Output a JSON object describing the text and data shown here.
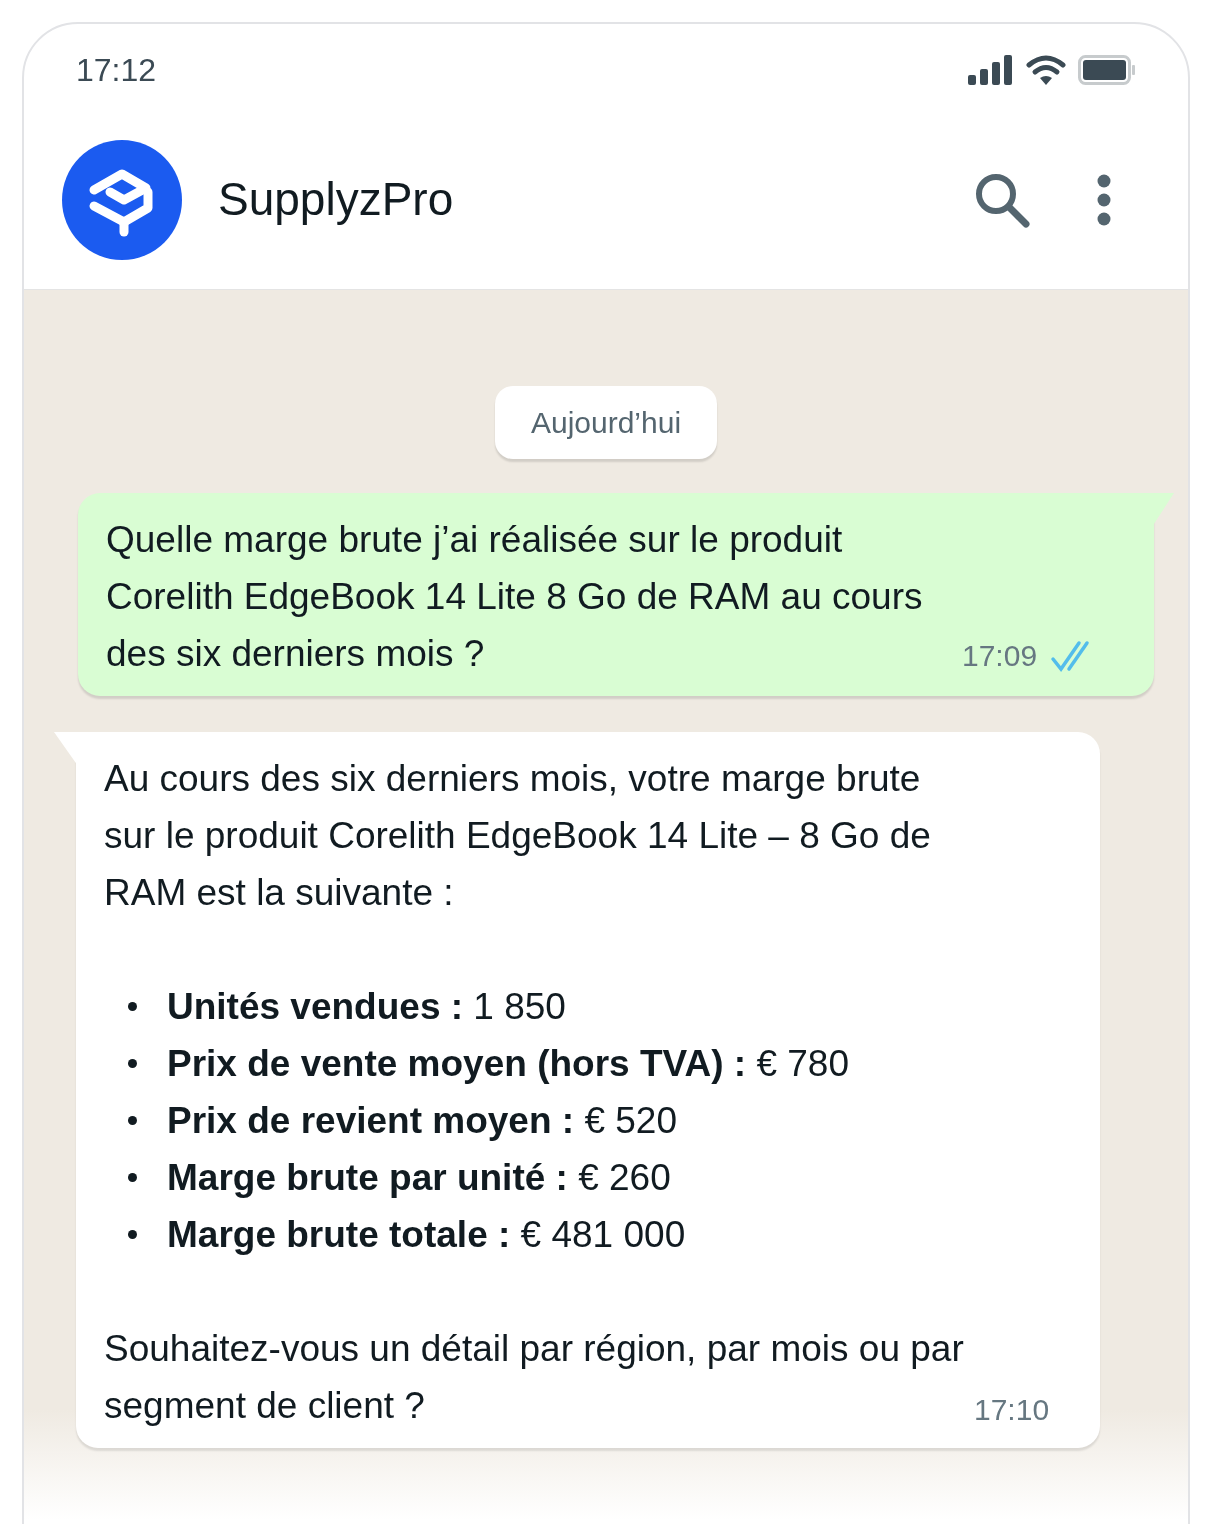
{
  "status_bar": {
    "time": "17:12"
  },
  "header": {
    "title": "SupplyzPro"
  },
  "date_chip": "Aujourd’hui",
  "messages": [
    {
      "kind": "outgoing",
      "text": "Quelle marge brute j’ai réalisée sur le produit Corelith EdgeBook 14 Lite 8 Go de RAM au cours des six derniers mois ?",
      "time": "17:09",
      "read": true
    },
    {
      "kind": "incoming",
      "intro": "Au cours des six derniers mois, votre marge brute sur le produit Corelith EdgeBook 14 Lite – 8 Go de RAM est la suivante :",
      "bullets": [
        "**Unités vendues :** 1 850",
        "**Prix de vente moyen (hors TVA) :**  € 780",
        "**Prix de revient moyen :**  € 520",
        "**Marge brute par unité :**  € 260",
        "**Marge brute totale :**  € 481 000"
      ],
      "outro": "Souhaitez-vous un détail par région, par mois ou par segment de client ?",
      "time": "17:10"
    }
  ]
}
